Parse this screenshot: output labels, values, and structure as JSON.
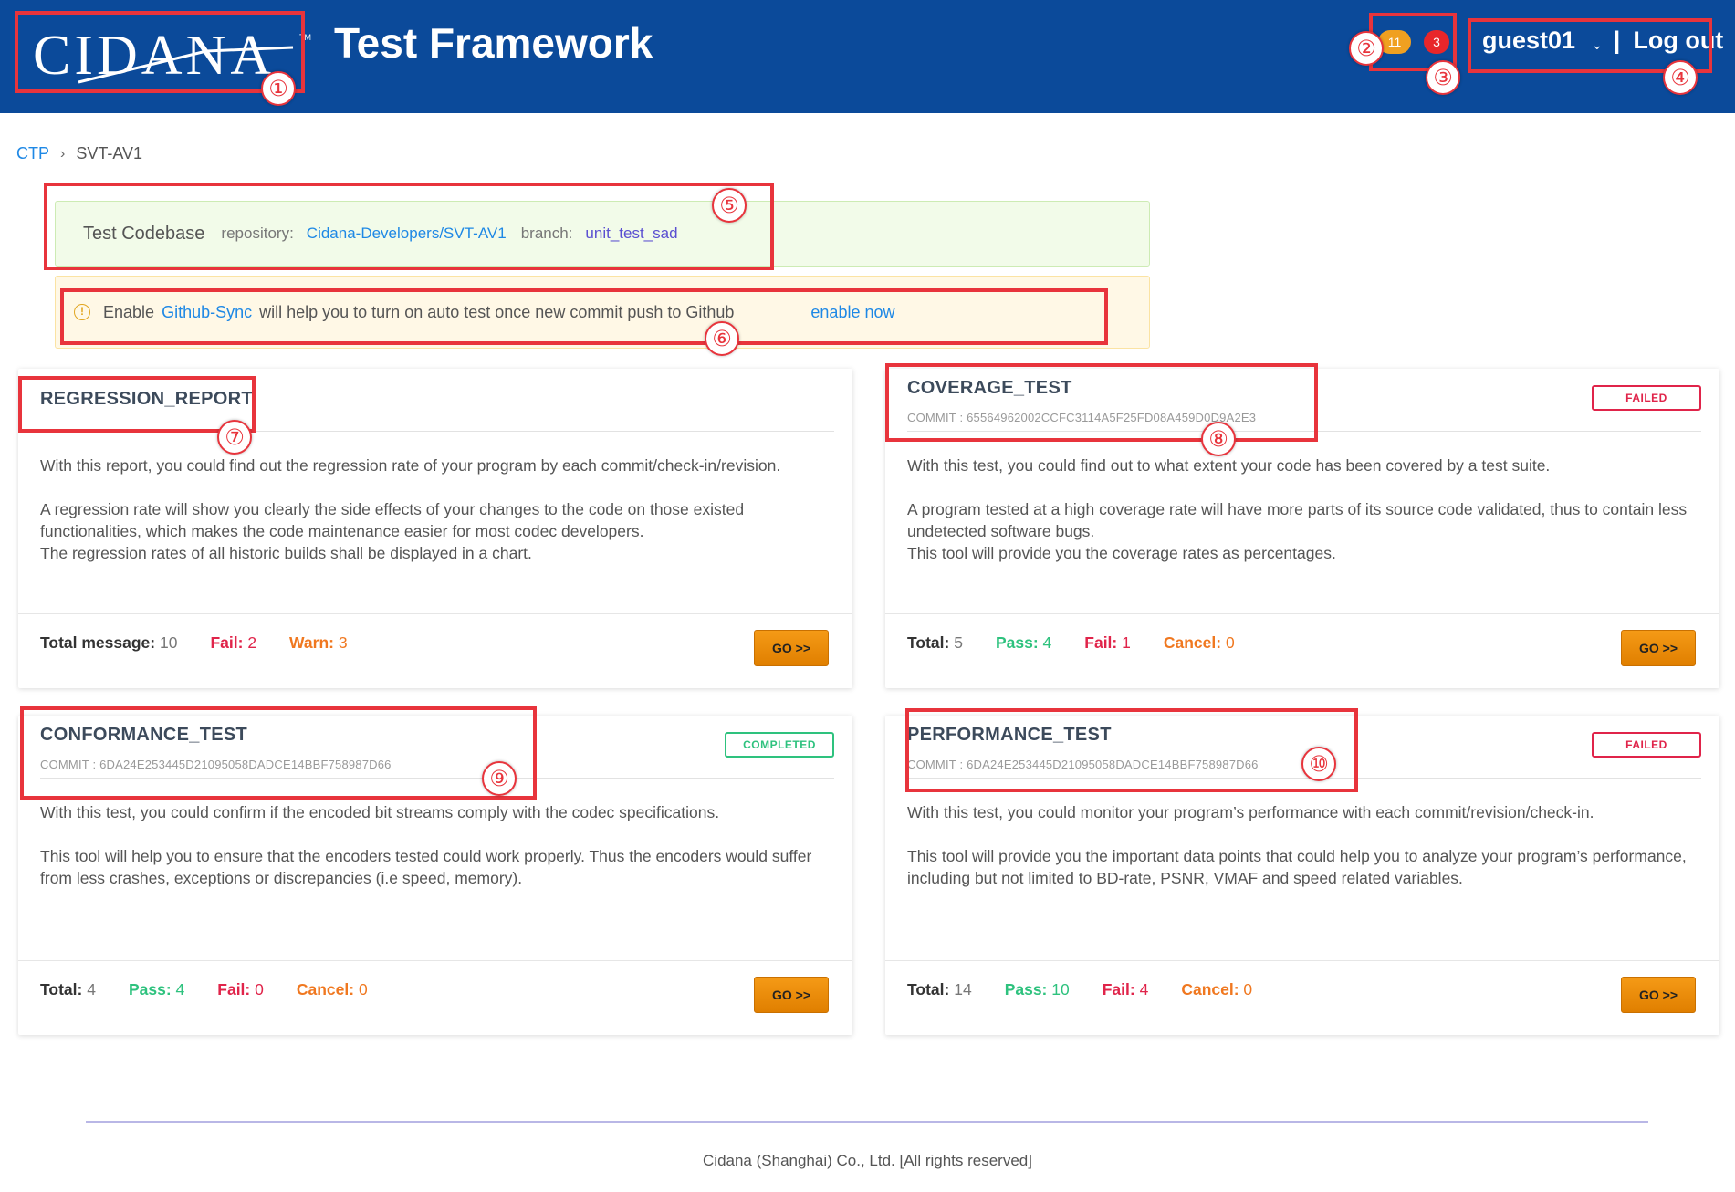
{
  "header": {
    "logo_text": "CIDANA",
    "logo_tm": "TM",
    "title": "Test Framework",
    "notifications": {
      "warning_count": "11",
      "error_count": "3"
    },
    "user": {
      "name": "guest01",
      "separator": "|",
      "logout_label": "Log out"
    }
  },
  "breadcrumb": {
    "items": [
      "CTP",
      "SVT-AV1"
    ]
  },
  "codebase": {
    "title": "Test Codebase",
    "repo_label": "repository:",
    "repo_value": "Cidana-Developers/SVT-AV1",
    "branch_label": "branch:",
    "branch_value": "unit_test_sad"
  },
  "alert": {
    "prefix": "Enable",
    "link": "Github-Sync",
    "message": "will help you to turn on auto test once new commit push to Github",
    "action": "enable now"
  },
  "cards": [
    {
      "title": "REGRESSION_REPORT",
      "commit": "",
      "status": "",
      "body": [
        "With this report, you could find out the regression rate of your program by each commit/check-in/revision.",
        "A regression rate will show you clearly the side effects of your changes to the code on those existed functionalities, which makes the code maintenance easier for most codec developers.\nThe regression rates of all historic builds shall be displayed in a chart."
      ],
      "stats": [
        {
          "label": "Total message:",
          "value": "10",
          "kind": "total"
        },
        {
          "label": "Fail:",
          "value": "2",
          "kind": "fail"
        },
        {
          "label": "Warn:",
          "value": "3",
          "kind": "warn"
        }
      ],
      "go_label": "GO >>"
    },
    {
      "title": "COVERAGE_TEST",
      "commit": "COMMIT : 65564962002CCFC3114A5F25FD08A459D0D9A2E3",
      "status": "FAILED",
      "body": [
        "With this test, you could find out to what extent your code has been covered by a test suite.",
        "A program tested at a high coverage rate will have more parts of its source code validated, thus to contain less undetected software bugs.\nThis tool will provide you the coverage rates as percentages."
      ],
      "stats": [
        {
          "label": "Total:",
          "value": "5",
          "kind": "total"
        },
        {
          "label": "Pass:",
          "value": "4",
          "kind": "pass"
        },
        {
          "label": "Fail:",
          "value": "1",
          "kind": "fail"
        },
        {
          "label": "Cancel:",
          "value": "0",
          "kind": "cancel"
        }
      ],
      "go_label": "GO >>"
    },
    {
      "title": "CONFORMANCE_TEST",
      "commit": "COMMIT : 6DA24E253445D21095058DADCE14BBF758987D66",
      "status": "COMPLETED",
      "body": [
        "With this test, you could confirm if the encoded bit streams comply with the codec specifications.",
        "This tool will help you to ensure that the encoders tested could work properly. Thus the encoders would suffer from less crashes, exceptions or discrepancies (i.e speed, memory)."
      ],
      "stats": [
        {
          "label": "Total:",
          "value": "4",
          "kind": "total"
        },
        {
          "label": "Pass:",
          "value": "4",
          "kind": "pass"
        },
        {
          "label": "Fail:",
          "value": "0",
          "kind": "fail"
        },
        {
          "label": "Cancel:",
          "value": "0",
          "kind": "cancel"
        }
      ],
      "go_label": "GO >>"
    },
    {
      "title": "PERFORMANCE_TEST",
      "commit": "COMMIT : 6DA24E253445D21095058DADCE14BBF758987D66",
      "status": "FAILED",
      "body": [
        "With this test, you could monitor your program’s performance with each commit/revision/check-in.",
        "This tool will provide you the important data points that could help you to analyze your program’s performance, including but not limited to BD-rate, PSNR, VMAF and speed related variables."
      ],
      "stats": [
        {
          "label": "Total:",
          "value": "14",
          "kind": "total"
        },
        {
          "label": "Pass:",
          "value": "10",
          "kind": "pass"
        },
        {
          "label": "Fail:",
          "value": "4",
          "kind": "fail"
        },
        {
          "label": "Cancel:",
          "value": "0",
          "kind": "cancel"
        }
      ],
      "go_label": "GO >>"
    }
  ],
  "annotations": [
    "①",
    "②",
    "③",
    "④",
    "⑤",
    "⑥",
    "⑦",
    "⑧",
    "⑨",
    "⑩"
  ],
  "footer": {
    "copyright": "Cidana (Shanghai) Co., Ltd. [All rights reserved]"
  },
  "colors": {
    "header_bg": "#0b4a9a",
    "annotation_red": "#e8343c",
    "link_blue": "#1e88e5",
    "pass_green": "#2ec27e",
    "fail_red": "#e0244a",
    "warn_orange": "#f07820",
    "go_orange": "#f59a16"
  }
}
